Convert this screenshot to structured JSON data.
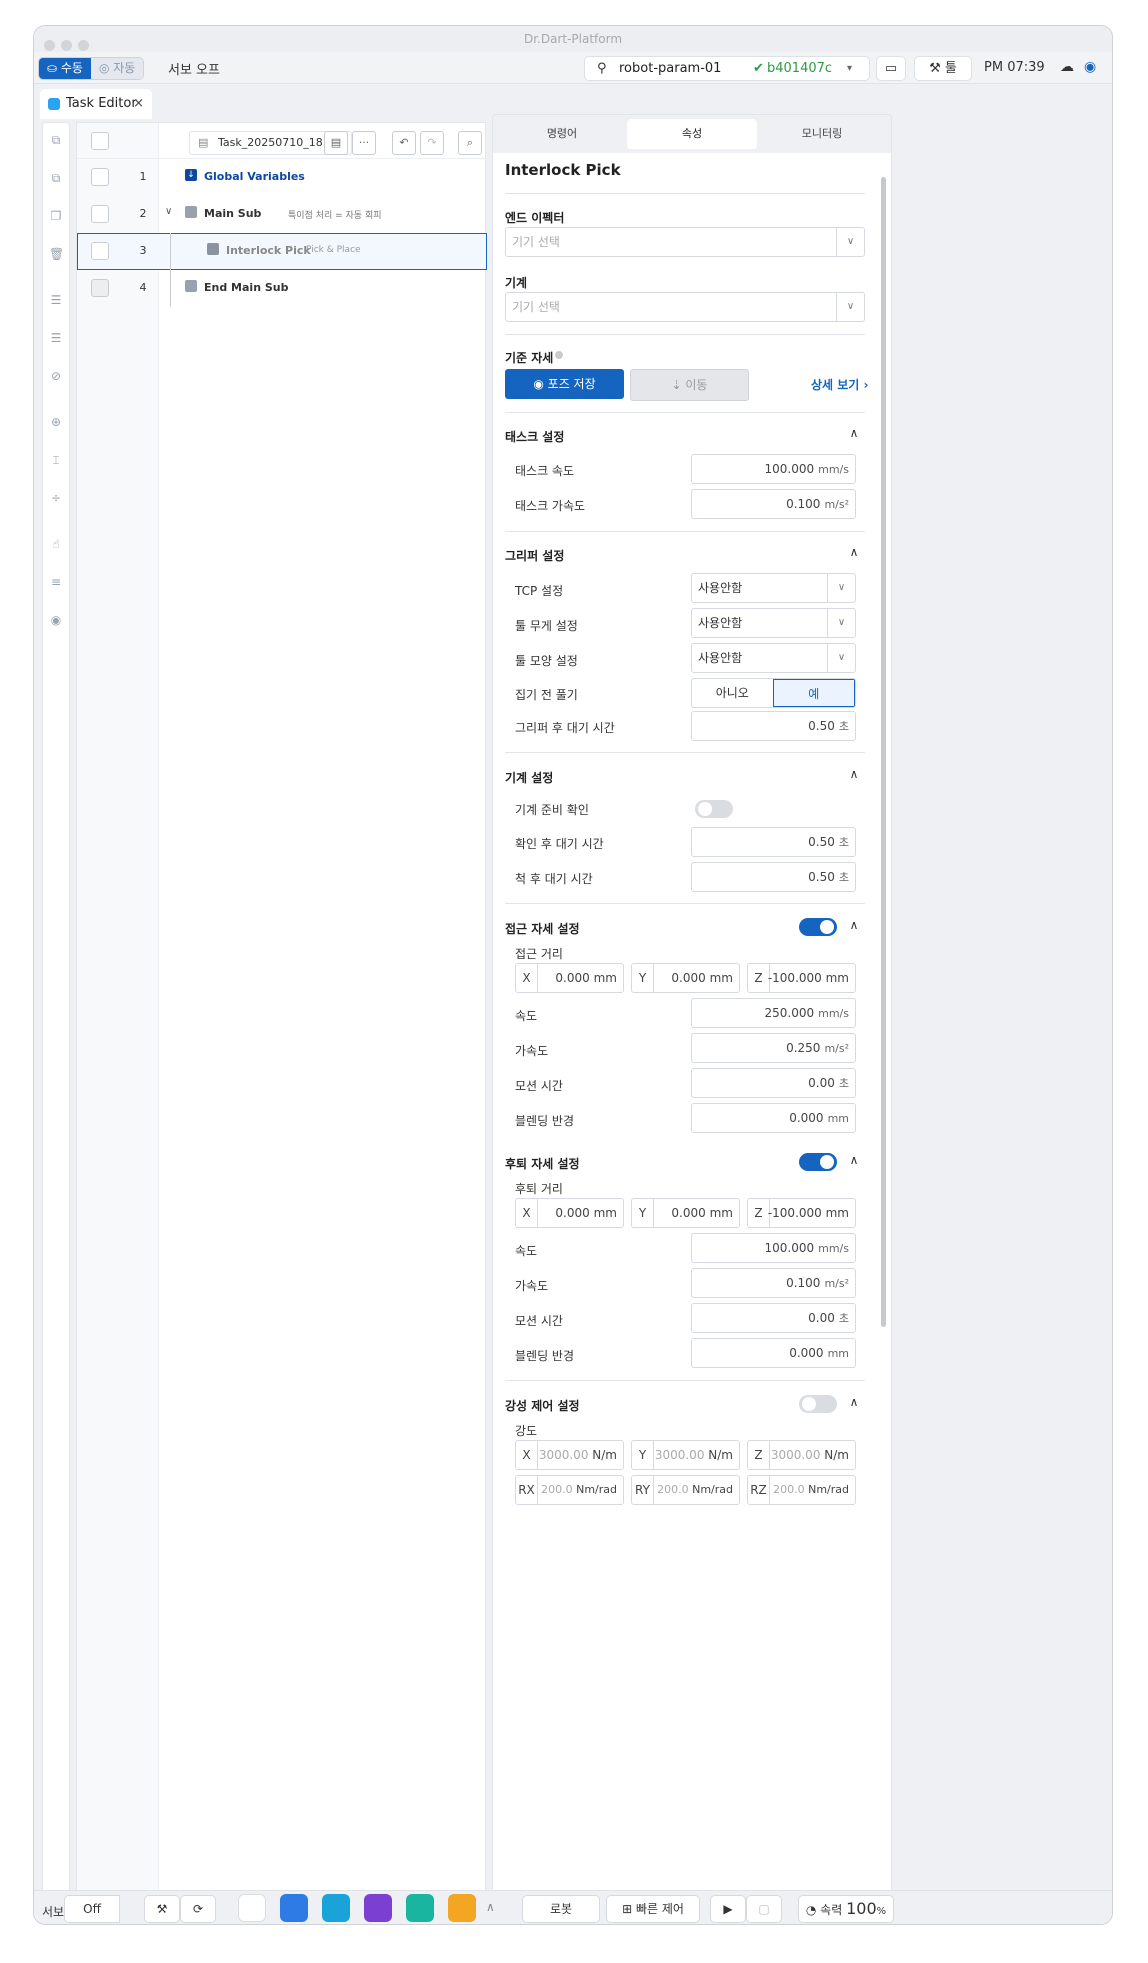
{
  "window": {
    "title": "Dr.Dart-Platform"
  },
  "topbar": {
    "mode_manual": "수동",
    "mode_auto": "자동",
    "servo": "서보 오프",
    "robot": "robot-param-01",
    "robot_hash": "b401407c",
    "tool": "툴",
    "clock": "PM 07:39"
  },
  "tab": {
    "label": "Task Editor",
    "close": "×"
  },
  "tree": {
    "filename": "Task_20250710_18...",
    "more": "···",
    "rows": [
      {
        "num": "1",
        "name": "Global Variables",
        "desc": ""
      },
      {
        "num": "2",
        "name": "Main Sub",
        "desc": "특이점 처리 = 자동 회피"
      },
      {
        "num": "3",
        "name": "Interlock Pick",
        "desc": "Pick & Place"
      },
      {
        "num": "4",
        "name": "End Main Sub",
        "desc": ""
      }
    ]
  },
  "right": {
    "tabs": [
      "명령어",
      "속성",
      "모니터링"
    ],
    "title": "Interlock Pick",
    "end_effector": {
      "label": "엔드 이펙터",
      "placeholder": "기기 선택"
    },
    "machine": {
      "label": "기계",
      "placeholder": "기기 선택"
    },
    "ref_pose": {
      "label": "기준 자세",
      "save": "포즈 저장",
      "move": "이동",
      "detail": "상세 보기"
    },
    "task": {
      "title": "태스크 설정",
      "speed_label": "태스크 속도",
      "speed": "100.000",
      "speed_unit": "mm/s",
      "accel_label": "태스크 가속도",
      "accel": "0.100",
      "accel_unit": "m/s²"
    },
    "gripper": {
      "title": "그리퍼 설정",
      "tcp_label": "TCP 설정",
      "tcp": "사용안함",
      "weight_label": "툴 무게 설정",
      "weight": "사용안함",
      "shape_label": "툴 모양 설정",
      "shape": "사용안함",
      "release_label": "집기 전 풀기",
      "no": "아니오",
      "yes": "예",
      "wait_label": "그리퍼 후 대기 시간",
      "wait": "0.50",
      "wait_unit": "초"
    },
    "machine_set": {
      "title": "기계 설정",
      "ready_label": "기계 준비 확인",
      "confirm_label": "확인 후 대기 시간",
      "confirm": "0.50",
      "confirm_unit": "초",
      "after_label": "척 후 대기 시간",
      "after": "0.50",
      "after_unit": "초"
    },
    "approach": {
      "title": "접근 자세 설정",
      "dist_label": "접근 거리",
      "x": "0.000",
      "y": "0.000",
      "z": "-100.000",
      "xyz_unit": "mm",
      "speed_label": "속도",
      "speed": "250.000",
      "speed_unit": "mm/s",
      "accel_label": "가속도",
      "accel": "0.250",
      "accel_unit": "m/s²",
      "time_label": "모션 시간",
      "time": "0.00",
      "time_unit": "초",
      "blend_label": "블렌딩 반경",
      "blend": "0.000",
      "blend_unit": "mm"
    },
    "retreat": {
      "title": "후퇴 자세 설정",
      "dist_label": "후퇴 거리",
      "x": "0.000",
      "y": "0.000",
      "z": "-100.000",
      "xyz_unit": "mm",
      "speed_label": "속도",
      "speed": "100.000",
      "speed_unit": "mm/s",
      "accel_label": "가속도",
      "accel": "0.100",
      "accel_unit": "m/s²",
      "time_label": "모션 시간",
      "time": "0.00",
      "time_unit": "초",
      "blend_label": "블렌딩 반경",
      "blend": "0.000",
      "blend_unit": "mm"
    },
    "compliance": {
      "title": "강성 제어 설정",
      "strength_label": "강도",
      "x": "3000.00",
      "y": "3000.00",
      "z": "3000.00",
      "lin_unit": "N/m",
      "rx": "200.0",
      "ry": "200.0",
      "rz": "200.0",
      "rot_unit": "Nm/rad"
    }
  },
  "bottom": {
    "servo_label": "서보",
    "servo_value": "Off",
    "robot_btn": "로봇",
    "quick": "빠른 제어",
    "speed_label": "속력",
    "speed_value": "100",
    "speed_unit": "%"
  },
  "labels": {
    "X": "X",
    "Y": "Y",
    "Z": "Z",
    "RX": "RX",
    "RY": "RY",
    "RZ": "RZ"
  }
}
